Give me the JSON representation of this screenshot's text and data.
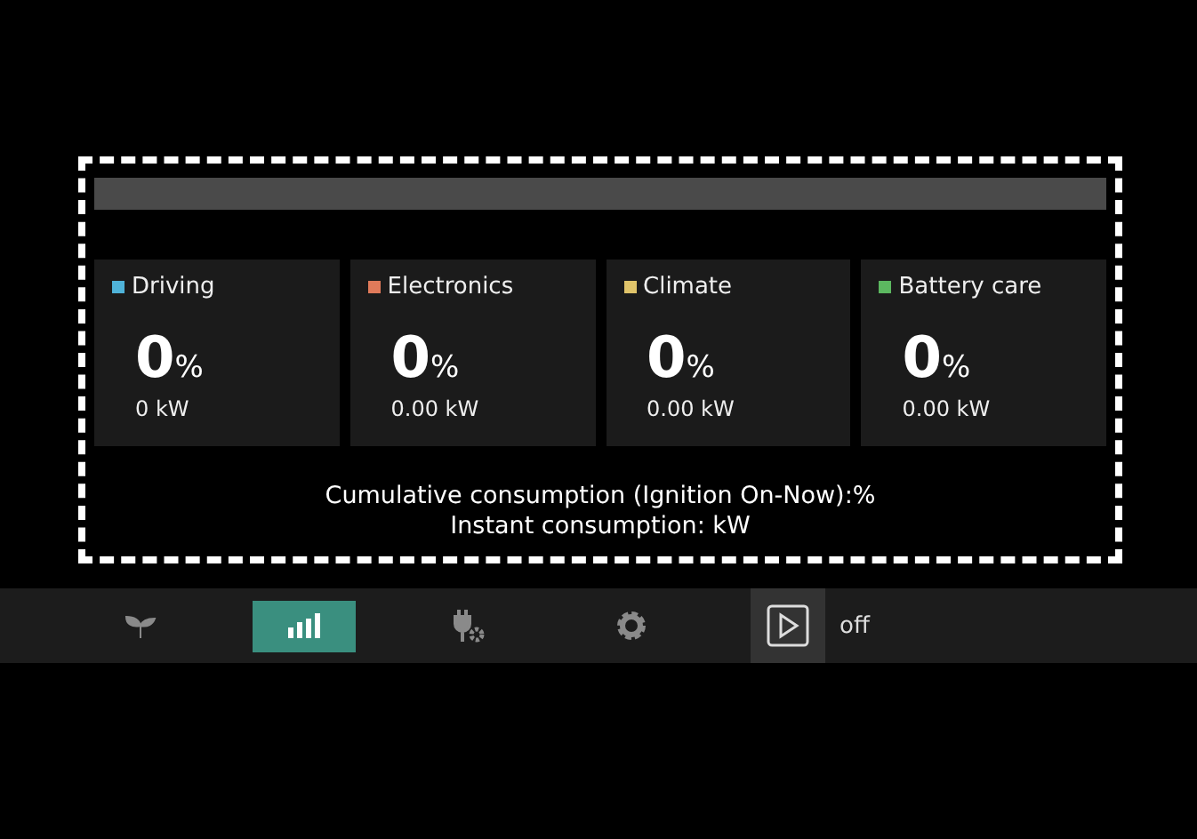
{
  "categories": [
    {
      "name": "Driving",
      "color": "#4fb3d9",
      "value": "0",
      "unit": "%",
      "power": "0 kW"
    },
    {
      "name": "Electronics",
      "color": "#e07a5a",
      "value": "0",
      "unit": "%",
      "power": "0.00 kW"
    },
    {
      "name": "Climate",
      "color": "#e0c46a",
      "value": "0",
      "unit": "%",
      "power": "0.00 kW"
    },
    {
      "name": "Battery care",
      "color": "#5cb860",
      "value": "0",
      "unit": "%",
      "power": "0.00 kW"
    }
  ],
  "summary": [
    "Cumulative consumption (Ignition On-Now):%",
    "Instant consumption: kW"
  ],
  "nav": [
    {
      "kind": "leaf",
      "selected": false
    },
    {
      "kind": "chart",
      "selected": true
    },
    {
      "kind": "plug",
      "selected": false
    },
    {
      "kind": "gear",
      "selected": false
    }
  ],
  "player": {
    "state": "off"
  }
}
